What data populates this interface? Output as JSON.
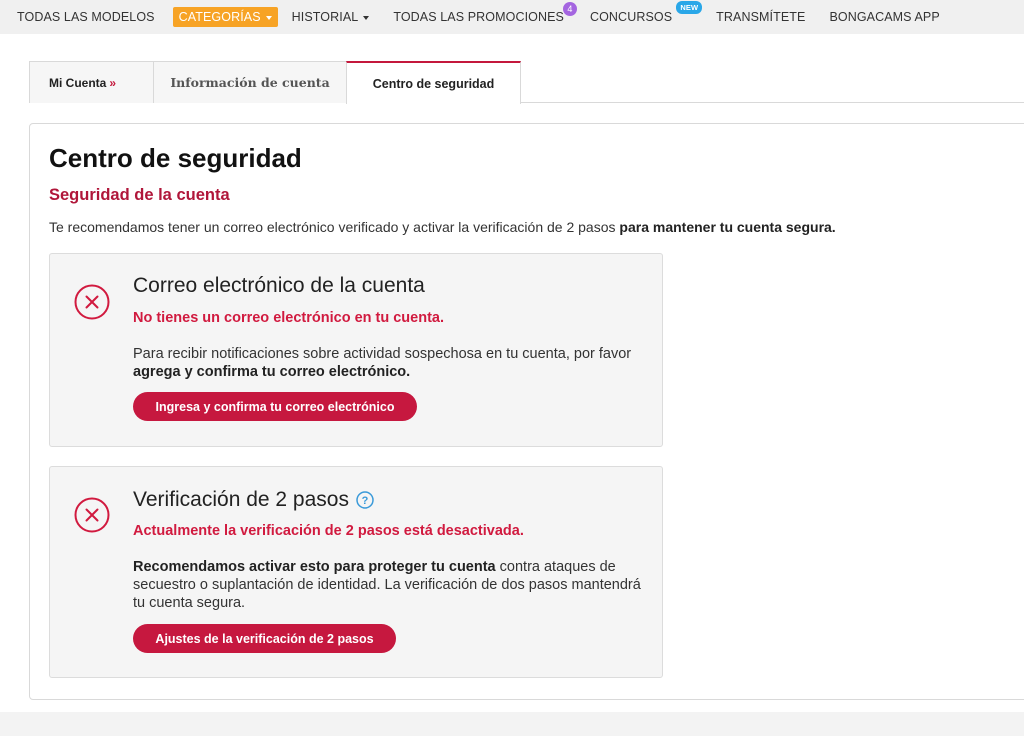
{
  "nav": {
    "items": [
      {
        "label": "TODAS LAS MODELOS"
      },
      {
        "label": "CATEGORÍAS"
      },
      {
        "label": "HISTORIAL"
      },
      {
        "label": "TODAS LAS PROMOCIONES",
        "badge": "4"
      },
      {
        "label": "CONCURSOS",
        "badge": "NEW"
      },
      {
        "label": "TRANSMÍTETE"
      },
      {
        "label": "BONGACAMS APP"
      }
    ]
  },
  "tabs": {
    "account": "Mi Cuenta",
    "account_arrow": "»",
    "info": "Información de cuenta",
    "security": "Centro de seguridad"
  },
  "main": {
    "title": "Centro de seguridad",
    "subtitle": "Seguridad de la cuenta",
    "intro_plain": "Te recomendamos tener un correo electrónico verificado y activar la verificación de 2 pasos",
    "intro_bold": "para mantener tu cuenta segura."
  },
  "email_card": {
    "title": "Correo electrónico de la cuenta",
    "alert": "No tienes un correo electrónico en tu cuenta.",
    "desc_plain": "Para recibir notificaciones sobre actividad sospechosa en tu cuenta, por favor",
    "desc_bold": "agrega y confirma tu correo electrónico.",
    "button": "Ingresa y confirma tu correo electrónico"
  },
  "twostep_card": {
    "title": "Verificación de 2 pasos",
    "alert": "Actualmente la verificación de 2 pasos está desactivada.",
    "desc_bold": "Recomendamos activar esto para proteger tu cuenta",
    "desc_plain": "contra ataques de secuestro o suplantación de identidad. La verificación de dos pasos mantendrá tu cuenta segura.",
    "button": "Ajustes de la verificación de 2 pasos"
  },
  "colors": {
    "accent": "#c6183f",
    "alert": "#d11a3f",
    "nav_active": "#f7a325",
    "badge_purple": "#a465e0",
    "badge_blue": "#2aa7e8"
  },
  "icons": {
    "status": "error-circle-x-icon",
    "help": "question-circle-icon",
    "dropdown": "caret-down-icon"
  }
}
